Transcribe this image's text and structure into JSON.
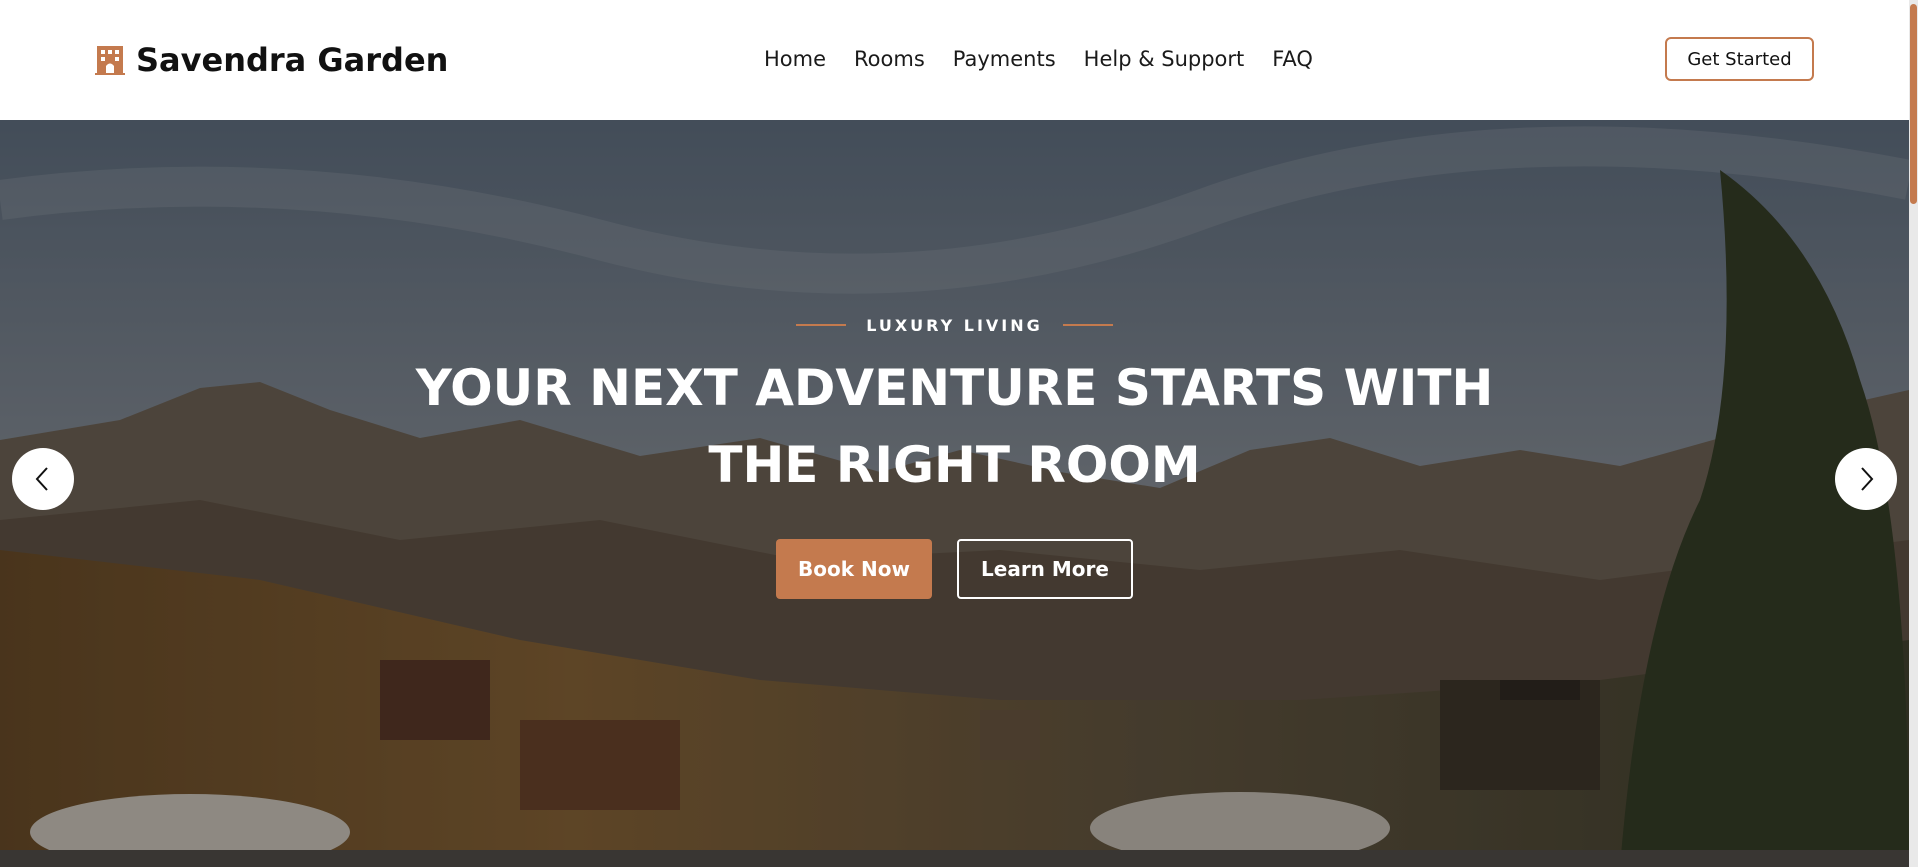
{
  "header": {
    "brand_name": "Savendra Garden",
    "brand_icon": "hotel-building-icon",
    "nav": [
      {
        "label": "Home"
      },
      {
        "label": "Rooms"
      },
      {
        "label": "Payments"
      },
      {
        "label": "Help & Support"
      },
      {
        "label": "FAQ"
      }
    ],
    "cta_label": "Get Started"
  },
  "hero": {
    "eyebrow": "LUXURY LIVING",
    "headline_line1": "YOUR NEXT ADVENTURE STARTS WITH",
    "headline_line2": "THE RIGHT ROOM",
    "primary_button": "Book Now",
    "secondary_button": "Learn More",
    "prev_icon": "chevron-left-icon",
    "next_icon": "chevron-right-icon"
  },
  "colors": {
    "accent": "#c47a4e",
    "text_dark": "#111111",
    "overlay": "rgba(20,18,16,0.38)"
  }
}
